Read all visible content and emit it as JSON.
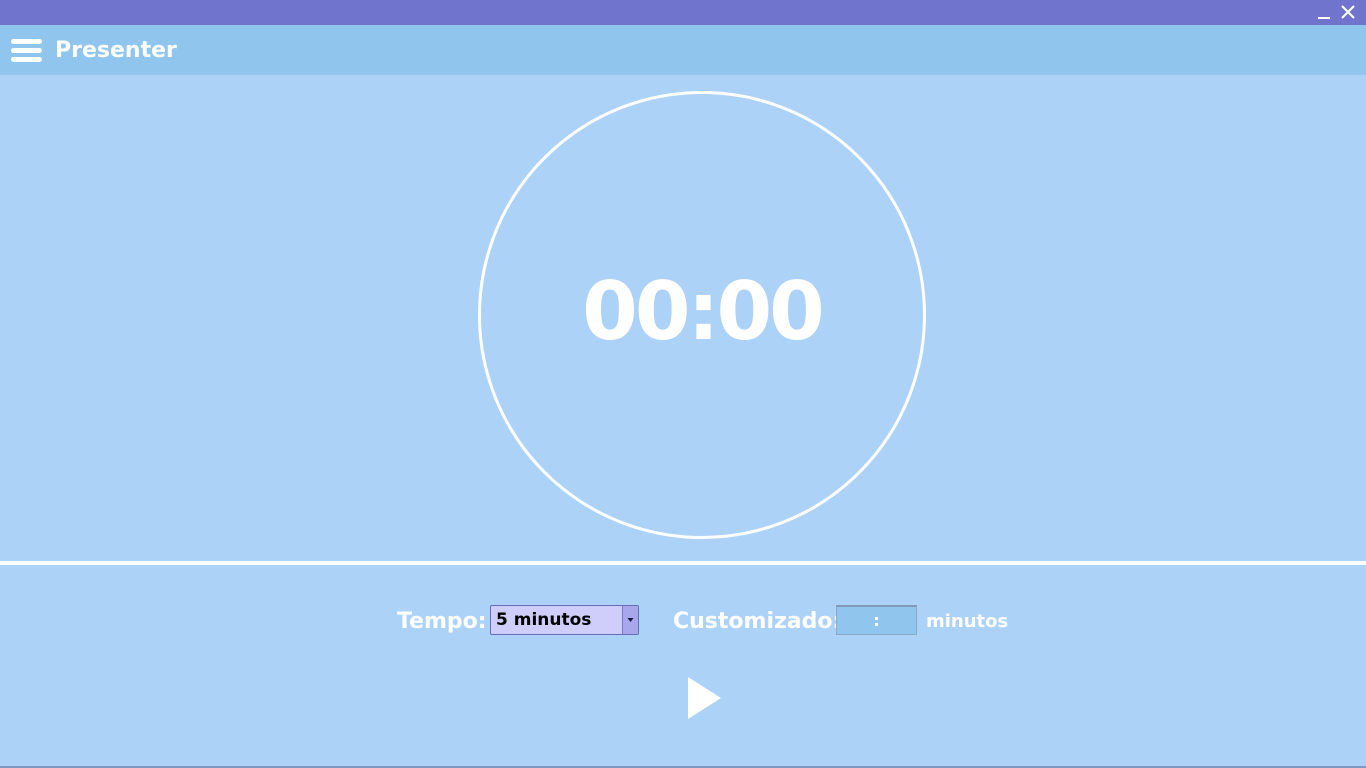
{
  "window": {
    "title_bar_color": "#7074cc",
    "controls": [
      {
        "name": "minimize",
        "icon": "minimize-icon"
      },
      {
        "name": "close",
        "icon": "close-icon"
      }
    ]
  },
  "header": {
    "menu_icon": "hamburger-menu-icon",
    "title": "Presenter",
    "background_color": "#90c5ee"
  },
  "timer": {
    "display": "00:00",
    "ring_color": "#ffffff"
  },
  "controls": {
    "tempo_label": "Tempo:",
    "tempo_selected": "5 minutos",
    "custom_label": "Customizado:",
    "custom_separator": ":",
    "custom_unit": "minutos",
    "play_icon": "play-icon"
  },
  "colors": {
    "background": "#add2f8",
    "accent": "#7074cc",
    "text": "#ffffff"
  }
}
